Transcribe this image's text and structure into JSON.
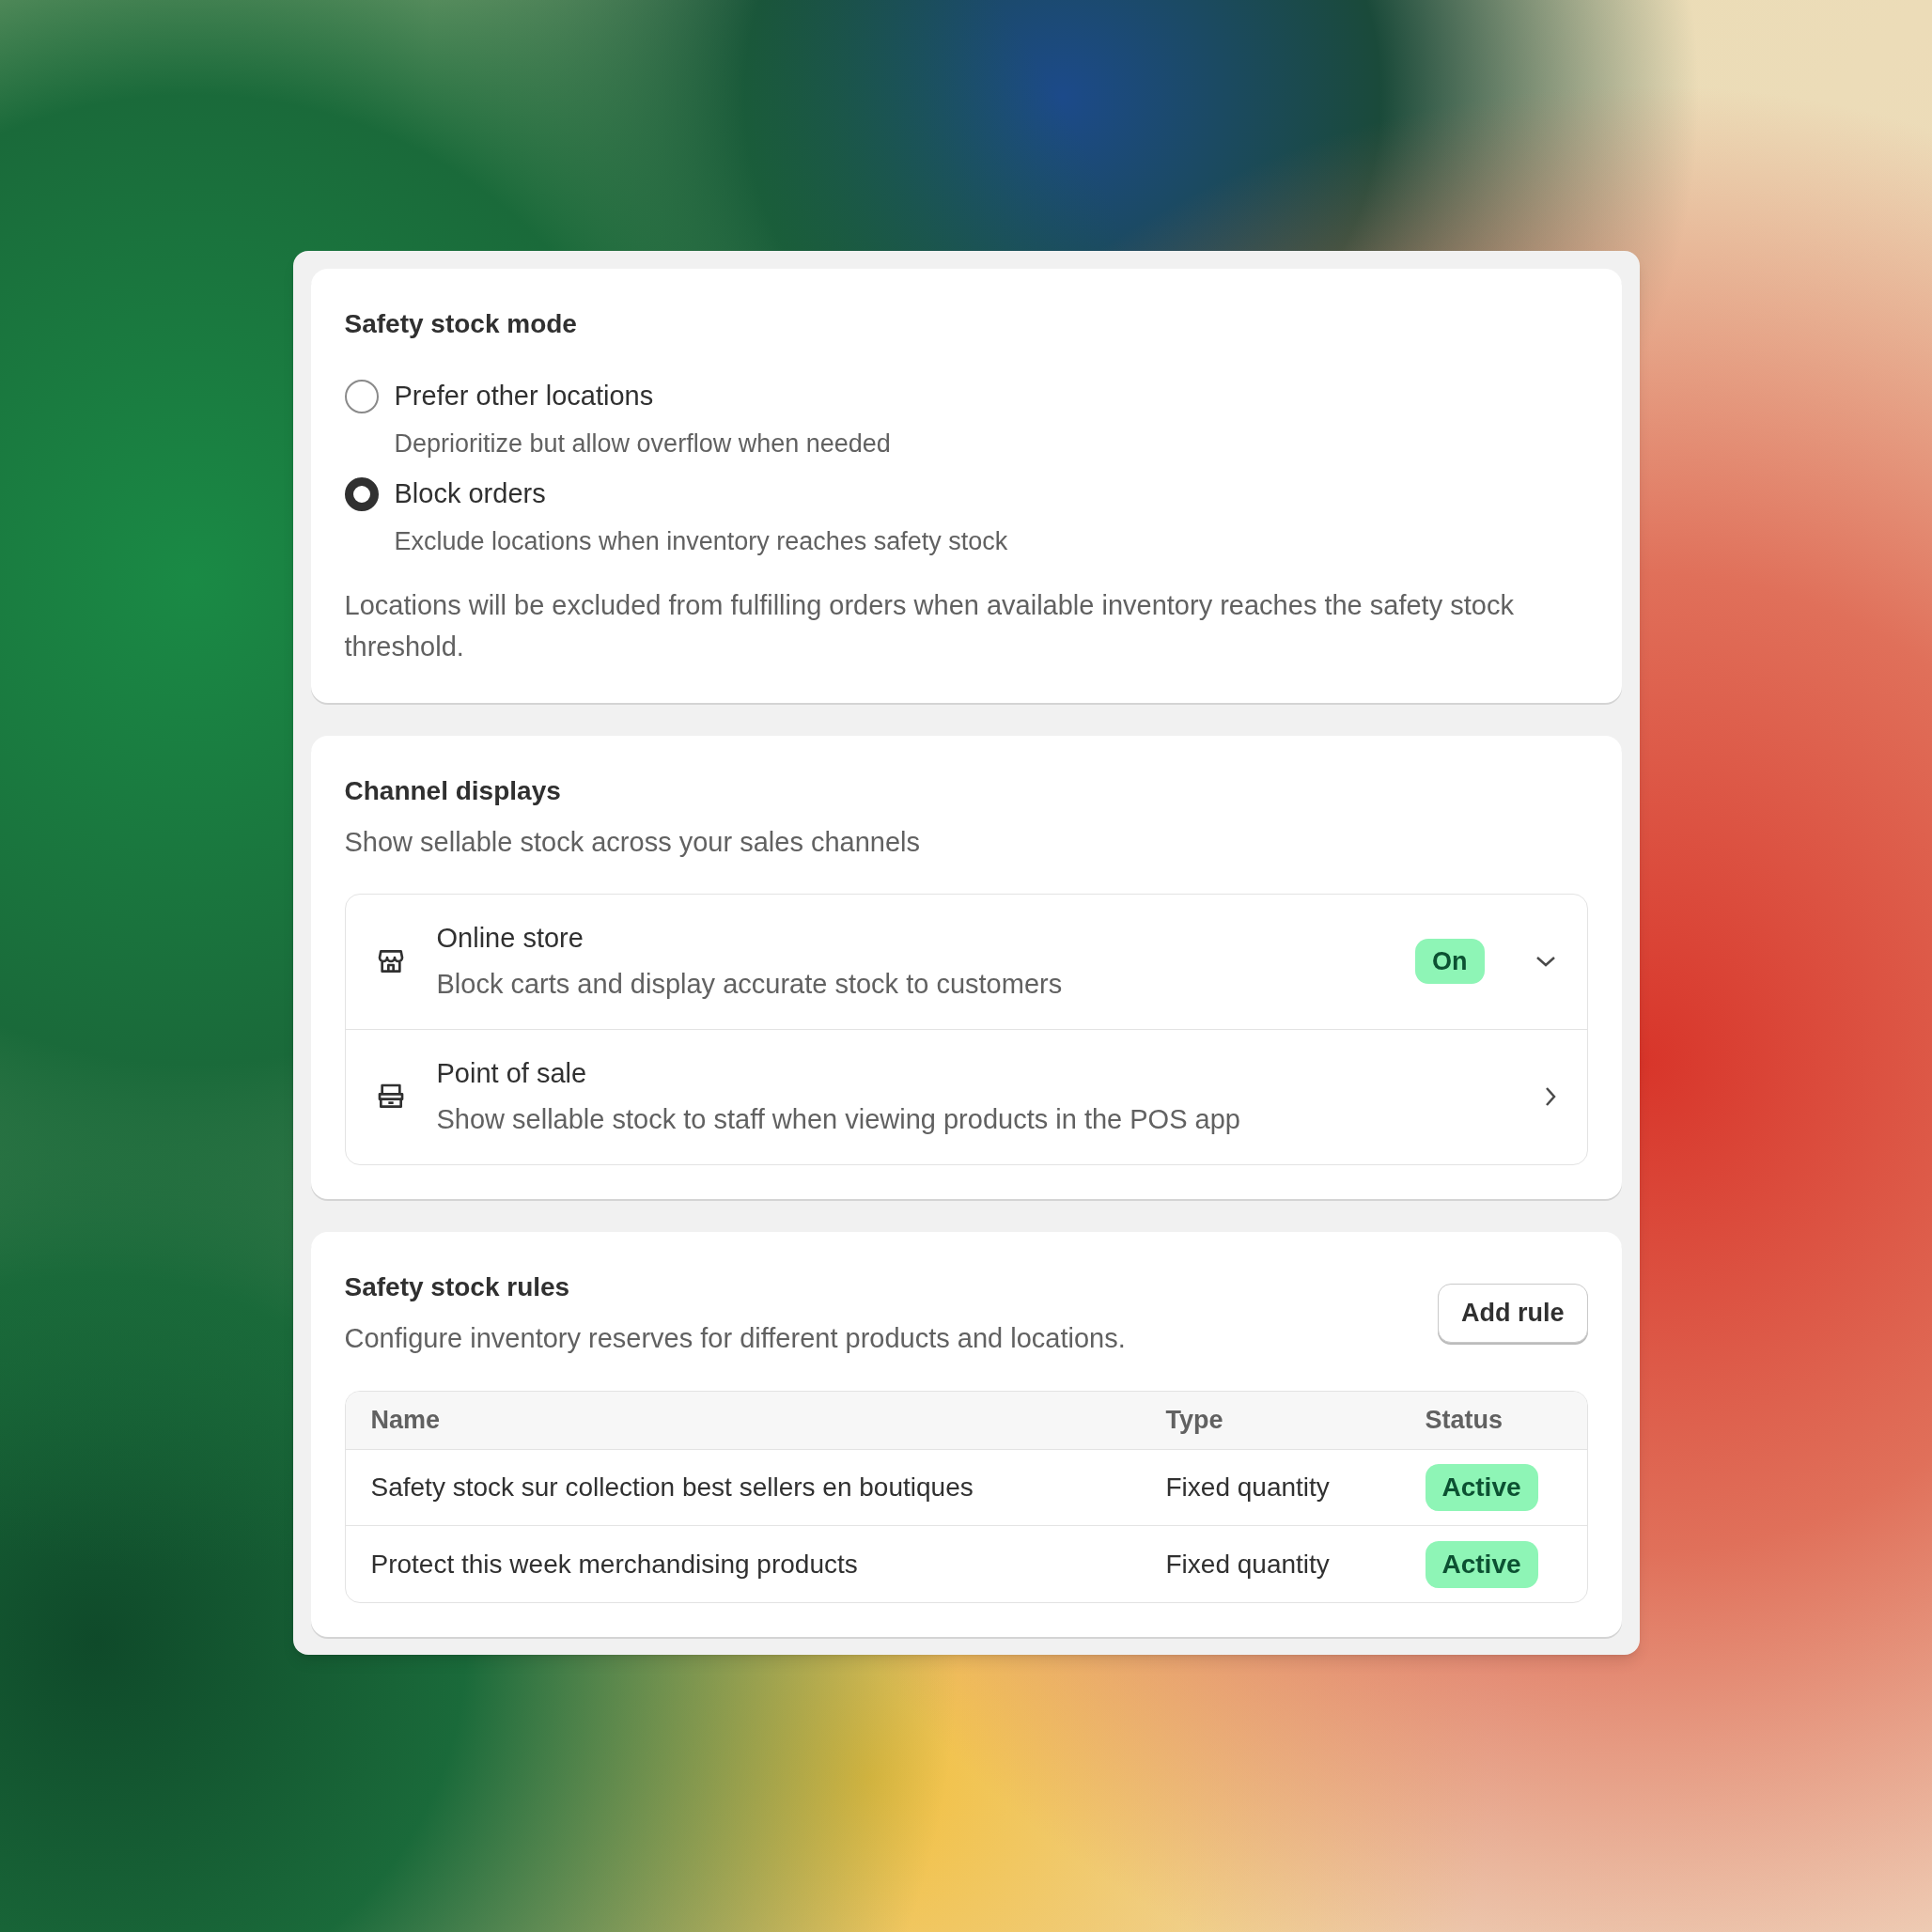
{
  "mode_card": {
    "title": "Safety stock mode",
    "options": [
      {
        "label": "Prefer other locations",
        "description": "Deprioritize but allow overflow when needed",
        "selected": false
      },
      {
        "label": "Block orders",
        "description": "Exclude locations when inventory reaches safety stock",
        "selected": true
      }
    ],
    "note": "Locations will be excluded from fulfilling orders when available inventory reaches the safety stock threshold."
  },
  "channels_card": {
    "title": "Channel displays",
    "subtitle": "Show sellable stock across your sales channels",
    "channels": [
      {
        "kind": "expand",
        "name": "Online store",
        "description": "Block carts and display accurate stock to customers",
        "badge": "On"
      },
      {
        "kind": "navigate",
        "name": "Point of sale",
        "description": "Show sellable stock to staff when viewing products in the POS app"
      }
    ]
  },
  "rules_card": {
    "title": "Safety stock rules",
    "subtitle": "Configure inventory reserves for different products and locations.",
    "button": "Add rule",
    "table": {
      "columns": [
        "Name",
        "Type",
        "Status"
      ],
      "rows": [
        {
          "name": "Safety stock sur collection best sellers en boutiques",
          "type": "Fixed quantity",
          "status": "Active"
        },
        {
          "name": "Protect this week merchandising products",
          "type": "Fixed quantity",
          "status": "Active"
        }
      ]
    }
  }
}
